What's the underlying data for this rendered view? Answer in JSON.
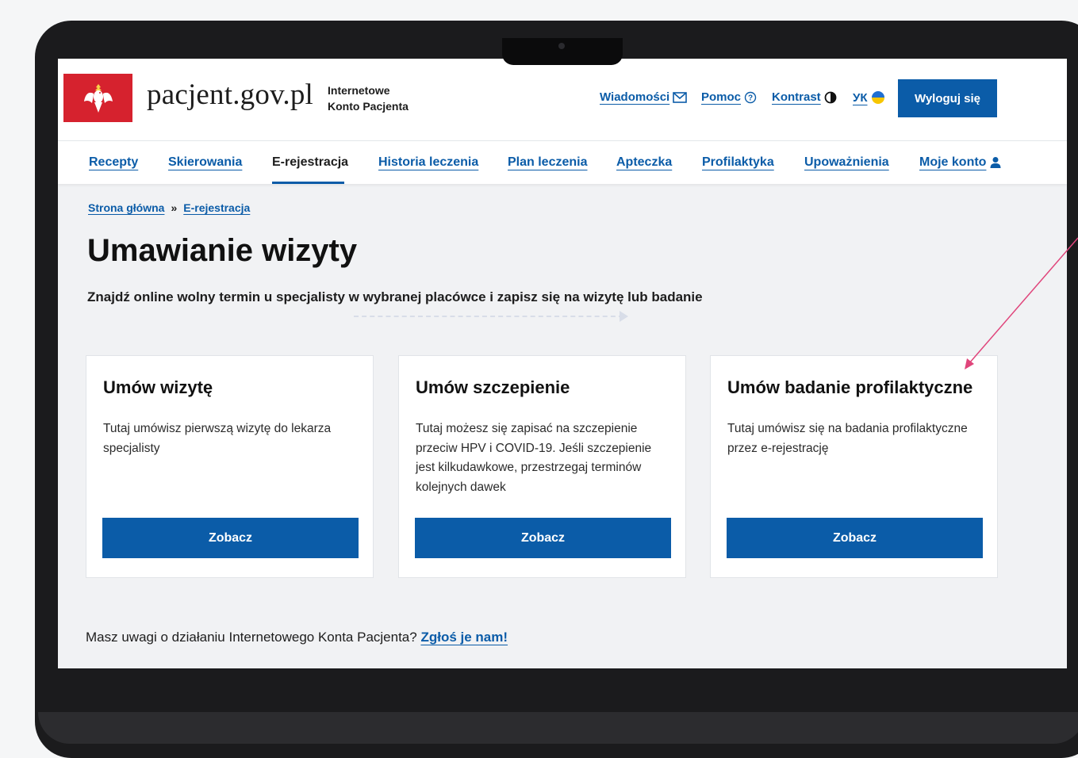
{
  "header": {
    "logo_text": "pacjent.gov.pl",
    "logo_subtitle_line1": "Internetowe",
    "logo_subtitle_line2": "Konto Pacjenta",
    "links": {
      "messages": "Wiadomości",
      "help": "Pomoc",
      "contrast": "Kontrast",
      "language": "УК"
    },
    "logout_label": "Wyloguj się"
  },
  "nav": {
    "items": [
      {
        "label": "Recepty"
      },
      {
        "label": "Skierowania"
      },
      {
        "label": "E-rejestracja"
      },
      {
        "label": "Historia leczenia"
      },
      {
        "label": "Plan leczenia"
      },
      {
        "label": "Apteczka"
      },
      {
        "label": "Profilaktyka"
      },
      {
        "label": "Upoważnienia"
      },
      {
        "label": "Moje konto"
      }
    ],
    "active": "E-rejestracja"
  },
  "breadcrumb": {
    "home": "Strona główna",
    "separator": "»",
    "current": "E-rejestracja"
  },
  "page": {
    "title": "Umawianie wizyty",
    "lead": "Znajdź online wolny termin u specjalisty w wybranej placówce i zapisz się na wizytę lub badanie"
  },
  "cards": [
    {
      "title": "Umów wizytę",
      "text": "Tutaj umówisz pierwszą wizytę do lekarza specjalisty",
      "button": "Zobacz"
    },
    {
      "title": "Umów szczepienie",
      "text": "Tutaj możesz się zapisać na szczepienie przeciw HPV i COVID-19. Jeśli szczepienie jest kilkudawkowe, przestrzegaj terminów kolejnych dawek",
      "button": "Zobacz"
    },
    {
      "title": "Umów badanie profilaktyczne",
      "text": "Tutaj umówisz się na badania profilaktyczne przez e-rejestrację",
      "button": "Zobacz"
    }
  ],
  "feedback": {
    "text": "Masz uwagi o działaniu Internetowego Konta Pacjenta?",
    "link": "Zgłoś je nam!"
  },
  "colors": {
    "brand_blue": "#0b5ca8",
    "emblem_red": "#d6222e",
    "annotation_pink": "#e0457b"
  }
}
